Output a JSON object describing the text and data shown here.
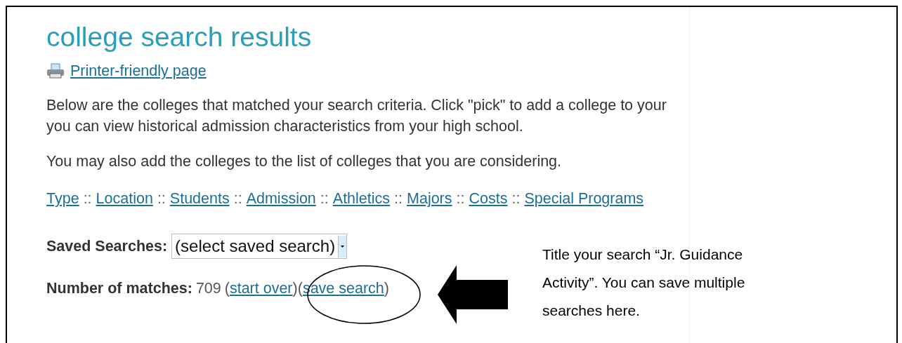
{
  "page": {
    "title": "college search results",
    "printer_link": "Printer-friendly page",
    "intro_lines": [
      "Below are the colleges that matched your search criteria. Click \"pick\" to add a college to your",
      "you can view historical admission characteristics from your high school."
    ],
    "note": "You may also add the colleges to the list of colleges that you are considering.",
    "filter_links": [
      {
        "kind": "link",
        "text": "Type"
      },
      {
        "kind": "separator",
        "text": "::"
      },
      {
        "kind": "link",
        "text": "Location"
      },
      {
        "kind": "separator",
        "text": "::"
      },
      {
        "kind": "link",
        "text": "Students"
      },
      {
        "kind": "separator",
        "text": "::"
      },
      {
        "kind": "link",
        "text": "Admission"
      },
      {
        "kind": "separator",
        "text": "::"
      },
      {
        "kind": "link",
        "text": "Athletics"
      },
      {
        "kind": "separator",
        "text": "::"
      },
      {
        "kind": "link",
        "text": "Majors"
      },
      {
        "kind": "separator",
        "text": "::"
      },
      {
        "kind": "link",
        "text": "Costs"
      },
      {
        "kind": "separator",
        "text": "::"
      },
      {
        "kind": "link",
        "text": "Special Programs"
      }
    ],
    "saved_searches": {
      "label": "Saved Searches:",
      "value": "(select saved search)"
    },
    "matches": {
      "label": "Number of matches:",
      "parts": [
        {
          "kind": "text",
          "text": "709"
        },
        {
          "kind": "text",
          "text": "("
        },
        {
          "kind": "link",
          "text": "start over"
        },
        {
          "kind": "text",
          "text": ")("
        },
        {
          "kind": "link",
          "text": "save search"
        },
        {
          "kind": "text",
          "text": ")"
        }
      ]
    }
  },
  "callout": {
    "lines": [
      "Title your search “Jr. Guidance",
      "Activity”. You can save multiple",
      "searches here."
    ]
  }
}
